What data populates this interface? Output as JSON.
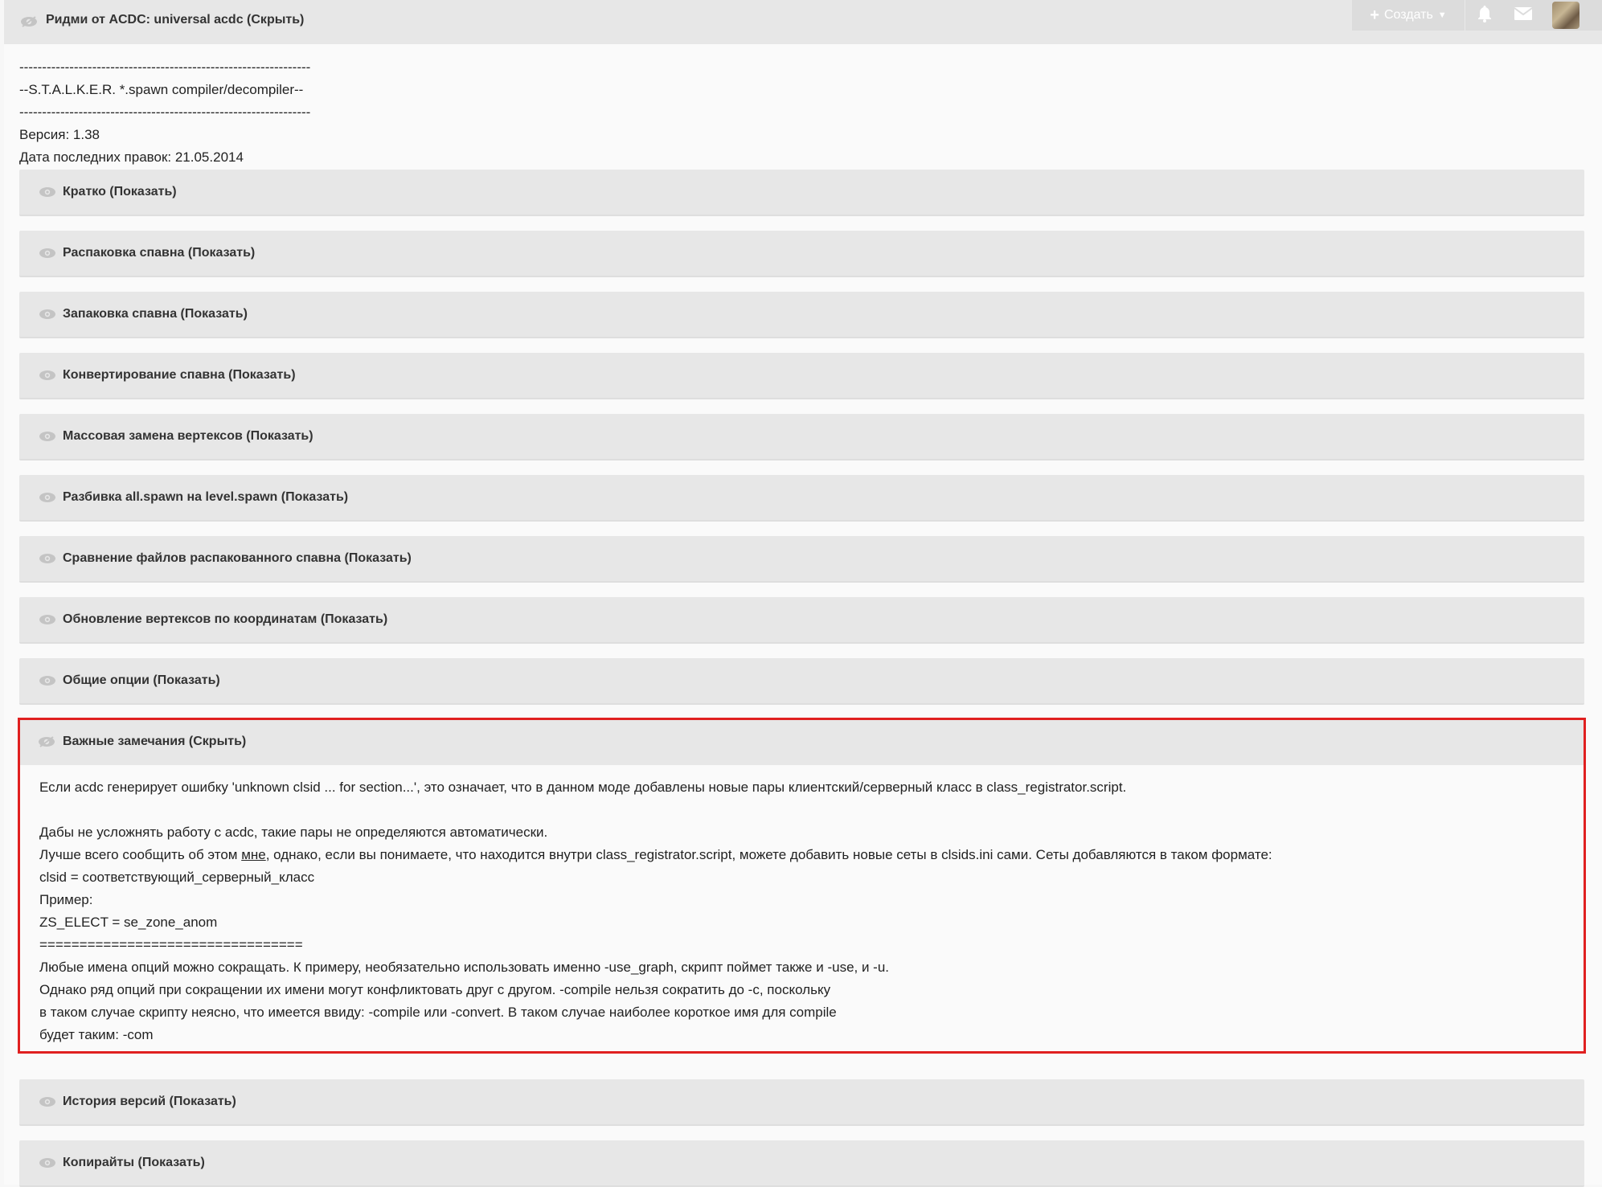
{
  "topbar": {
    "create_label": "Создать",
    "create_icon": "plus-icon",
    "dropdown_icon": "caret-down-icon",
    "bell_icon": "bell-icon",
    "mail_icon": "envelope-icon",
    "avatar_icon": "avatar"
  },
  "top_spoiler": {
    "title": "Ридми от ACDC: universal acdc (Скрыть)"
  },
  "intro": {
    "line1": "----------------------------------------------------------------",
    "line2": "--S.T.A.L.K.E.R. *.spawn compiler/decompiler--",
    "line3": "----------------------------------------------------------------",
    "version": "Версия: 1.38",
    "date": "Дата последних правок: 21.05.2014"
  },
  "spoilers": [
    {
      "label": "Кратко (Показать)"
    },
    {
      "label": "Распаковка спавна (Показать)"
    },
    {
      "label": "Запаковка спавна (Показать)"
    },
    {
      "label": "Конвертирование спавна (Показать)"
    },
    {
      "label": "Массовая замена вертексов (Показать)"
    },
    {
      "label": "Разбивка all.spawn на level.spawn (Показать)"
    },
    {
      "label": "Сравнение файлов распакованного спавна (Показать)"
    },
    {
      "label": "Обновление вертексов по координатам (Показать)"
    },
    {
      "label": "Общие опции (Показать)"
    }
  ],
  "open_spoiler": {
    "label": "Важные замечания (Скрыть)",
    "lines": {
      "l1": "Если acdc генерирует ошибку 'unknown clsid ... for section...', это означает, что в данном моде добавлены новые пары клиентский/серверный класс в class_registrator.script.",
      "l2": "",
      "l3": "Дабы не усложнять работу с acdc, такие пары не определяются автоматически.",
      "l4_before": "Лучше всего сообщить об этом ",
      "l4_link": "мне",
      "l4_after": ", однако, если вы понимаете, что находится внутри class_registrator.script, можете добавить новые сеты в clsids.ini сами. Сеты добавляются в таком формате:",
      "l5": "clsid = соответствующий_серверный_класс",
      "l6": "Пример:",
      "l7": "ZS_ELECT = se_zone_anom",
      "l8": "=================================",
      "l9": "Любые имена опций можно сокращать. К примеру, необязательно использовать именно -use_graph, скрипт поймет также и -use, и -u.",
      "l10": "Однако ряд опций при сокращении их имени могут конфликтовать друг с другом. -compile нельзя сократить до -c, поскольку",
      "l11": "в таком случае скрипту неясно, что имеется ввиду: -compile или -convert. В таком случае наиболее короткое имя для compile",
      "l12": "будет таким: -com"
    }
  },
  "bottom_spoilers": [
    {
      "label": "История версий (Показать)"
    },
    {
      "label": "Копирайты (Показать)"
    }
  ],
  "colors": {
    "highlight_border": "#e02020",
    "spoiler_bg": "#e7e7e7",
    "page_bg": "#fafafa"
  }
}
